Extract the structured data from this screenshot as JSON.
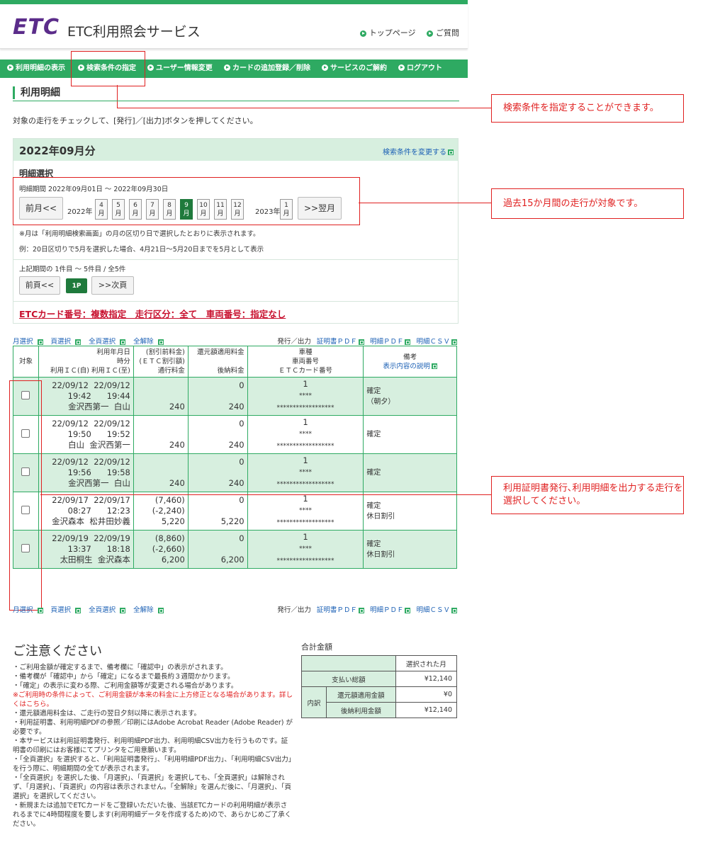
{
  "header": {
    "logo": "ETC",
    "service_name": "ETC利用照会サービス",
    "links": [
      "トップページ",
      "ご質問"
    ]
  },
  "nav": [
    "利用明細の表示",
    "検索条件の指定",
    "ユーザー情報変更",
    "カードの追加登録／削除",
    "サービスのご解約",
    "ログアウト"
  ],
  "section_title": "利用明細",
  "instruction": "対象の走行をチェックして、[発行]／[出力]ボタンを押してください。",
  "callouts": [
    "検索条件を指定することができます。",
    "過去15か月間の走行が対象です。",
    "利用証明書発行､利用明細を出力する走行を選択してください。"
  ],
  "panel": {
    "month_title": "2022年09月分",
    "change_link": "検索条件を変更する",
    "subtitle": "明細選択",
    "period": "明細期間 2022年09月01日 ～ 2022年09月30日",
    "prev_month": "前月<<",
    "next_month": ">>翌月",
    "year1": "2022年",
    "year2": "2023年",
    "months_2022": [
      "4",
      "5",
      "6",
      "7",
      "8",
      "9",
      "10",
      "11",
      "12"
    ],
    "months_2023": [
      "1"
    ],
    "month_char": "月",
    "selected_month": "9",
    "note1": "※月は「利用明細検索画面」の月の区切り日で選択したとおりに表示されます。",
    "note2": "例：20日区切りで5月を選択した場合、4月21日～5月20日までを5月として表示",
    "range": "上記期間の 1件目 ～ 5件目 / 全5件",
    "prev_page": "前頁<<",
    "page": "1P",
    "next_page": ">>次頁",
    "card_info": "ETCカード番号：複数指定　走行区分：全て　車両番号：指定なし"
  },
  "select_links": [
    "月選択",
    "頁選択",
    "全頁選択",
    "全解除"
  ],
  "output": {
    "label": "発行／出力",
    "links": [
      "証明書ＰＤＦ",
      "明細ＰＤＦ",
      "明細ＣＳＶ"
    ]
  },
  "table": {
    "headers": {
      "target": "対象",
      "date_l1": "利用年月日",
      "date_l2": "時分",
      "date_l3": "利用ＩＣ(自) 利用ＩＣ(至)",
      "fee_l1": "(割引前料金)",
      "fee_l2": "(ＥＴＣ割引額)",
      "fee_l3": "通行料金",
      "refund_l1": "還元額適用料金",
      "refund_l2": "後納料金",
      "car_l1": "車種",
      "car_l2": "車両番号",
      "car_l3": "ＥＴＣカード番号",
      "note_l1": "備考",
      "note_l2": "表示内容の説明"
    },
    "rows": [
      {
        "from_date": "22/09/12",
        "to_date": "22/09/12",
        "from_time": "19:42",
        "to_time": "19:44",
        "from_ic": "金沢西第一",
        "to_ic": "白山",
        "before": "",
        "discount": "",
        "toll": "240",
        "refund": "0",
        "deferred": "240",
        "car_type": "1",
        "car_no": "****",
        "card_no": "******************",
        "note1": "確定",
        "note2": "（朝夕）"
      },
      {
        "from_date": "22/09/12",
        "to_date": "22/09/12",
        "from_time": "19:50",
        "to_time": "19:52",
        "from_ic": "白山",
        "to_ic": "金沢西第一",
        "before": "",
        "discount": "",
        "toll": "240",
        "refund": "0",
        "deferred": "240",
        "car_type": "1",
        "car_no": "****",
        "card_no": "******************",
        "note1": "確定",
        "note2": ""
      },
      {
        "from_date": "22/09/12",
        "to_date": "22/09/12",
        "from_time": "19:56",
        "to_time": "19:58",
        "from_ic": "金沢西第一",
        "to_ic": "白山",
        "before": "",
        "discount": "",
        "toll": "240",
        "refund": "0",
        "deferred": "240",
        "car_type": "1",
        "car_no": "****",
        "card_no": "******************",
        "note1": "確定",
        "note2": ""
      },
      {
        "from_date": "22/09/17",
        "to_date": "22/09/17",
        "from_time": "08:27",
        "to_time": "12:23",
        "from_ic": "金沢森本",
        "to_ic": "松井田妙義",
        "before": "(7,460)",
        "discount": "(-2,240)",
        "toll": "5,220",
        "refund": "0",
        "deferred": "5,220",
        "car_type": "1",
        "car_no": "****",
        "card_no": "******************",
        "note1": "確定",
        "note2": "休日割引"
      },
      {
        "from_date": "22/09/19",
        "to_date": "22/09/19",
        "from_time": "13:37",
        "to_time": "18:18",
        "from_ic": "太田桐生",
        "to_ic": "金沢森本",
        "before": "(8,860)",
        "discount": "(-2,660)",
        "toll": "6,200",
        "refund": "0",
        "deferred": "6,200",
        "car_type": "1",
        "car_no": "****",
        "card_no": "******************",
        "note1": "確定",
        "note2": "休日割引"
      }
    ]
  },
  "warnings": {
    "title": "ご注意ください",
    "items": [
      "・ご利用金額が確定するまで、備考欄に「確認中」の表示がされます。",
      "・備考欄が「確認中」から「確定」になるまで最長約３週間かかります。",
      "・「確定」の表示に変わる際、ご利用金額等が変更される場合があります。",
      "※ご利用時の条件によって、ご利用金額が本来の料金に上方修正となる場合があります。詳しくはこちら。",
      "・還元額適用料金は、ご走行の翌日夕刻以降に表示されます。",
      "・利用証明書、利用明細PDFの参照／印刷にはAdobe Acrobat Reader (Adobe Reader) が必要です。",
      "・本サービスは利用証明書発行、利用明細PDF出力、利用明細CSV出力を行うものです。証明書の印刷にはお客様にてプリンタをご用意願います。",
      "・「全頁選択」を選択すると、「利用証明書発行」、「利用明細PDF出力」、「利用明細CSV出力」を行う際に、明細期間の全てが表示されます。",
      "・「全頁選択」を選択した後、「月選択」、「頁選択」を選択しても、「全頁選択」は解除されず、「月選択」、「頁選択」の内容は表示されません。「全解除」を選んだ後に、「月選択」、「頁選択」を選択してください。",
      "・新規または追加でETCカードをご登録いただいた後、当該ETCカードの利用明細が表示されるまでに4時間程度を要します(利用明細データを作成するため)ので、あらかじめご了承ください。"
    ]
  },
  "summary": {
    "title": "合計金額",
    "col_header": "選択された月",
    "total_label": "支払い総額",
    "total": "¥12,140",
    "breakdown_label": "内訳",
    "refund_label": "還元額適用金額",
    "refund": "¥0",
    "deferred_label": "後納利用金額",
    "deferred": "¥12,140"
  }
}
